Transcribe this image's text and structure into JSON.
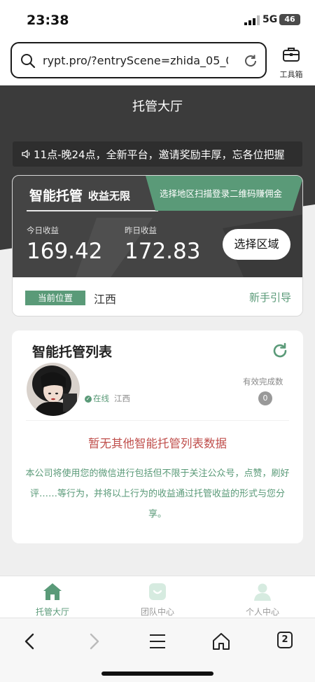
{
  "status": {
    "time": "23:38",
    "network": "5G",
    "battery": "46"
  },
  "browser": {
    "url": "rypt.pro/?entryScene=zhida_05_00...",
    "toolbox_label": "工具箱",
    "tab_count": "2"
  },
  "page": {
    "title": "托管大厅"
  },
  "notice": {
    "text": "11点-晚24点，全新平台，邀请奖励丰厚，忘各位把握"
  },
  "earnings": {
    "brand": "智能托管",
    "brand_sub": "收益无限",
    "banner": "选择地区扫描登录二维码赚佣金",
    "today_label": "今日收益",
    "today_value": "169.42",
    "yesterday_label": "昨日收益",
    "yesterday_value": "172.83",
    "select_region": "选择区域",
    "position_label": "当前位置",
    "province": "江西",
    "guide": "新手引导"
  },
  "list": {
    "title": "智能托管列表",
    "online": "在线",
    "region": "江西",
    "effective_label": "有效完成数",
    "effective_count": "0",
    "empty": "暂无其他智能托管列表数据",
    "description": "本公司将使用您的微信进行包括但不限于关注公众号，点赞，刷好评……等行为，并将以上行为的收益通过托管收益的形式与您分享。"
  },
  "tabs": [
    {
      "label": "托管大厅",
      "active": true
    },
    {
      "label": "团队中心",
      "active": false
    },
    {
      "label": "个人中心",
      "active": false
    }
  ],
  "colors": {
    "accent": "#5a9a78",
    "dark": "#3b3b3b",
    "empty_text": "#c0504d"
  }
}
